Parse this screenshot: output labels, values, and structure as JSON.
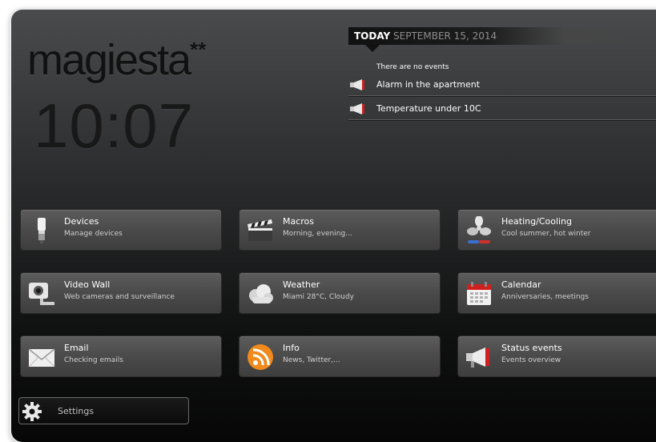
{
  "brand": {
    "name": "magiesta",
    "mark": "**"
  },
  "clock": {
    "time": "10:07"
  },
  "events": {
    "today_label": "TODAY",
    "date": "SEPTEMBER 15, 2014",
    "empty_text": "There are no events",
    "items": [
      {
        "label": "Alarm in the apartment",
        "icon": "megaphone-icon"
      },
      {
        "label": "Temperature under 10C",
        "icon": "megaphone-icon"
      }
    ]
  },
  "tiles": [
    {
      "title": "Devices",
      "subtitle": "Manage devices",
      "icon": "lightbulb-icon"
    },
    {
      "title": "Macros",
      "subtitle": "Morning, evening...",
      "icon": "clapperboard-icon"
    },
    {
      "title": "Heating/Cooling",
      "subtitle": "Cool summer, hot winter",
      "icon": "fan-icon"
    },
    {
      "title": "Video Wall",
      "subtitle": "Web cameras and surveillance",
      "icon": "camera-icon"
    },
    {
      "title": "Weather",
      "subtitle": "Miami 28°C, Cloudy",
      "icon": "cloud-icon"
    },
    {
      "title": "Calendar",
      "subtitle": "Anniversaries, meetings",
      "icon": "calendar-icon"
    },
    {
      "title": "Email",
      "subtitle": "Checking emails",
      "icon": "envelope-icon"
    },
    {
      "title": "Info",
      "subtitle": "News, Twitter,...",
      "icon": "rss-icon"
    },
    {
      "title": "Status events",
      "subtitle": "Events overview",
      "icon": "megaphone-icon"
    }
  ],
  "settings": {
    "label": "Settings",
    "icon": "gear-icon"
  },
  "colors": {
    "accent_red": "#d01f1f",
    "rss_orange": "#f08a1c",
    "text": "#ffffff"
  }
}
